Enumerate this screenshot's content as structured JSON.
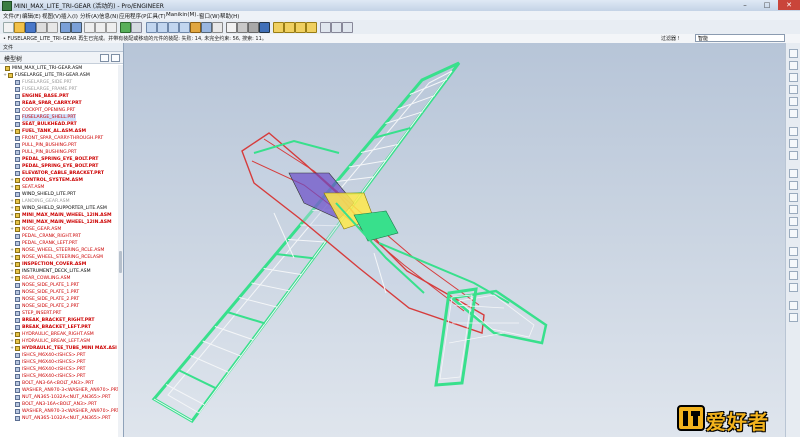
{
  "window": {
    "title": "MINI_MAX_LITE_TRI-GEAR (活动的) - Pro/ENGINEER",
    "controls": [
      "–",
      "□",
      "✕"
    ]
  },
  "menu": [
    "文件(F)",
    "编辑(E)",
    "视图(V)",
    "插入(I)",
    "分析(A)",
    "信息(N)",
    "应用程序(P)",
    "工具(T)",
    "Manikin(M)...",
    "窗口(W)",
    "帮助(H)"
  ],
  "status": {
    "message": "• FUSELARGE_LITE_TRI-GEAR 再生已完成。并带有装配或移动的元件的装配: 失败: 14, 未完全约束: 56, 搜索: 11。",
    "filter_label": "过滤器 !",
    "filter_value": "智能"
  },
  "panel": {
    "tab": "文件",
    "header": "模型树"
  },
  "tree": [
    {
      "label": "MINI_MAX_LITE_TRI-GEAR.ASM",
      "color": "#000000",
      "bold": false,
      "level": 0,
      "icon": "asm"
    },
    {
      "label": "FUSELARGE_LITE_TRI-GEAR.ASM",
      "color": "#000000",
      "bold": false,
      "level": 1,
      "icon": "asm"
    },
    {
      "label": "FUSELARGE_SIDE.PRT",
      "color": "#9a9a9a",
      "bold": false,
      "level": 2,
      "icon": "prt"
    },
    {
      "label": "FUSELARGE_FRAME.PRT",
      "color": "#9a9a9a",
      "bold": false,
      "level": 2,
      "icon": "prt"
    },
    {
      "label": "ENGINE_BASE.PRT",
      "color": "#cc0000",
      "bold": true,
      "level": 2,
      "icon": "prt"
    },
    {
      "label": "REAR_SPAR_CARRY.PRT",
      "color": "#cc0000",
      "bold": true,
      "level": 2,
      "icon": "prt"
    },
    {
      "label": "COCKPIT_OPENING.PRT",
      "color": "#cc0000",
      "bold": false,
      "level": 2,
      "icon": "prt"
    },
    {
      "label": "FUSELARGE_SHELL.PRT",
      "color": "#cc0000",
      "bold": false,
      "level": 2,
      "icon": "prt",
      "selected": true
    },
    {
      "label": "SEAT_BULKHEAD.PRT",
      "color": "#cc0000",
      "bold": true,
      "level": 2,
      "icon": "prt"
    },
    {
      "label": "FUEL_TANK_AL.ASM.ASM",
      "color": "#cc0000",
      "bold": true,
      "level": 2,
      "icon": "asm"
    },
    {
      "label": "FRONT_SPAR_CARRY-THROUGH.PRT",
      "color": "#cc0000",
      "bold": false,
      "level": 2,
      "icon": "prt"
    },
    {
      "label": "PULL_PIN_BUSHING.PRT",
      "color": "#cc0000",
      "bold": false,
      "level": 2,
      "icon": "prt"
    },
    {
      "label": "PULL_PIN_BUSHING.PRT",
      "color": "#cc0000",
      "bold": false,
      "level": 2,
      "icon": "prt"
    },
    {
      "label": "PEDAL_SPRING_EYE_BOLT.PRT",
      "color": "#cc0000",
      "bold": true,
      "level": 2,
      "icon": "prt"
    },
    {
      "label": "PEDAL_SPRING_EYE_BOLT.PRT",
      "color": "#cc0000",
      "bold": true,
      "level": 2,
      "icon": "prt"
    },
    {
      "label": "ELEVATOR_CABLE_BRACKET.PRT",
      "color": "#cc0000",
      "bold": true,
      "level": 2,
      "icon": "prt"
    },
    {
      "label": "CONTROL_SYSTEM.ASM",
      "color": "#cc0000",
      "bold": true,
      "level": 2,
      "icon": "asm"
    },
    {
      "label": "SEAT.ASM",
      "color": "#cc0000",
      "bold": false,
      "level": 2,
      "icon": "asm"
    },
    {
      "label": "WIND_SHIELD_LITE.PRT",
      "color": "#000000",
      "bold": false,
      "level": 2,
      "icon": "prt"
    },
    {
      "label": "LANDING_GEAR.ASM",
      "color": "#9a9a9a",
      "bold": false,
      "level": 2,
      "icon": "asm"
    },
    {
      "label": "WIND_SHIELD_SUPPORTER_LITE.ASM",
      "color": "#000000",
      "bold": false,
      "level": 2,
      "icon": "asm"
    },
    {
      "label": "MINI_MAX_MAIN_WHEEL_12IN.ASM",
      "color": "#cc0000",
      "bold": true,
      "level": 2,
      "icon": "asm"
    },
    {
      "label": "MINI_MAX_MAIN_WHEEL_12IN.ASM",
      "color": "#cc0000",
      "bold": true,
      "level": 2,
      "icon": "asm"
    },
    {
      "label": "NOSE_GEAR.ASM",
      "color": "#cc0000",
      "bold": false,
      "level": 2,
      "icon": "asm"
    },
    {
      "label": "PEDAL_CRANK_RIGHT.PRT",
      "color": "#cc0000",
      "bold": false,
      "level": 2,
      "icon": "prt"
    },
    {
      "label": "PEDAL_CRANK_LEFT.PRT",
      "color": "#cc0000",
      "bold": false,
      "level": 2,
      "icon": "prt"
    },
    {
      "label": "NOSE_WHEEL_STEERING_RCLE.ASM",
      "color": "#cc0000",
      "bold": false,
      "level": 2,
      "icon": "asm"
    },
    {
      "label": "NOSE_WHEEL_STEERING_RCELASM",
      "color": "#cc0000",
      "bold": false,
      "level": 2,
      "icon": "asm"
    },
    {
      "label": "INSPECTION_COVER.ASM",
      "color": "#cc0000",
      "bold": true,
      "level": 2,
      "icon": "asm"
    },
    {
      "label": "INSTRUMENT_DECK_LITE.ASM",
      "color": "#000000",
      "bold": false,
      "level": 2,
      "icon": "asm"
    },
    {
      "label": "REAR_COWLING.ASM",
      "color": "#cc0000",
      "bold": false,
      "level": 2,
      "icon": "asm"
    },
    {
      "label": "NOSE_SIDE_PLATE_1.PRT",
      "color": "#cc0000",
      "bold": false,
      "level": 2,
      "icon": "prt"
    },
    {
      "label": "NOSE_SIDE_PLATE_1.PRT",
      "color": "#cc0000",
      "bold": false,
      "level": 2,
      "icon": "prt"
    },
    {
      "label": "NOSE_SIDE_PLATE_2.PRT",
      "color": "#cc0000",
      "bold": false,
      "level": 2,
      "icon": "prt"
    },
    {
      "label": "NOSE_SIDE_PLATE_2.PRT",
      "color": "#cc0000",
      "bold": false,
      "level": 2,
      "icon": "prt"
    },
    {
      "label": "STEP_INSERT.PRT",
      "color": "#cc0000",
      "bold": false,
      "level": 2,
      "icon": "prt"
    },
    {
      "label": "BREAK_BRACKET_RIGHT.PRT",
      "color": "#cc0000",
      "bold": true,
      "level": 2,
      "icon": "prt"
    },
    {
      "label": "BREAK_BRACKET_LEFT.PRT",
      "color": "#cc0000",
      "bold": true,
      "level": 2,
      "icon": "prt"
    },
    {
      "label": "HYDRAULIC_BREAK_RIGHT.ASM",
      "color": "#cc0000",
      "bold": false,
      "level": 2,
      "icon": "asm"
    },
    {
      "label": "HYDRAULIC_BREAK_LEFT.ASM",
      "color": "#cc0000",
      "bold": false,
      "level": 2,
      "icon": "asm"
    },
    {
      "label": "HYDRAULIC_TEE_TUBE_MINI MAX.ASI",
      "color": "#cc0000",
      "bold": true,
      "level": 2,
      "icon": "asm"
    },
    {
      "label": "ISHCS_M6X40<ISHCS>.PRT",
      "color": "#cc0000",
      "bold": false,
      "level": 2,
      "icon": "prt"
    },
    {
      "label": "ISHCS_M6X40<ISHCS>.PRT",
      "color": "#cc0000",
      "bold": false,
      "level": 2,
      "icon": "prt"
    },
    {
      "label": "ISHCS_M6X40<ISHCS>.PRT",
      "color": "#cc0000",
      "bold": false,
      "level": 2,
      "icon": "prt"
    },
    {
      "label": "ISHCS_M6X40<ISHCS>.PRT",
      "color": "#cc0000",
      "bold": false,
      "level": 2,
      "icon": "prt"
    },
    {
      "label": "BOLT_AN3-6A<BOLT_AN3>.PRT",
      "color": "#cc0000",
      "bold": false,
      "level": 2,
      "icon": "prt"
    },
    {
      "label": "WASHER_AN970-3<WASHER_AN970>.PRT",
      "color": "#cc0000",
      "bold": false,
      "level": 2,
      "icon": "prt"
    },
    {
      "label": "NUT_AN365-1032A<NUT_AN365>.PRT",
      "color": "#cc0000",
      "bold": false,
      "level": 2,
      "icon": "prt"
    },
    {
      "label": "BOLT_AN3-16A<BOLT_AN3>.PRT",
      "color": "#cc0000",
      "bold": false,
      "level": 2,
      "icon": "prt"
    },
    {
      "label": "WASHER_AN970-3<WASHER_AN970>.PRT",
      "color": "#cc0000",
      "bold": false,
      "level": 2,
      "icon": "prt"
    },
    {
      "label": "NUT_AN365-1032A<NUT_AN365>.PRT",
      "color": "#cc0000",
      "bold": false,
      "level": 2,
      "icon": "prt"
    }
  ],
  "watermark": {
    "text": "爱好者"
  },
  "colors": {
    "model_green": "#38e08c",
    "model_red": "#d63c3c",
    "model_white": "#f4f6f8",
    "selection": "#cfe3ff"
  }
}
